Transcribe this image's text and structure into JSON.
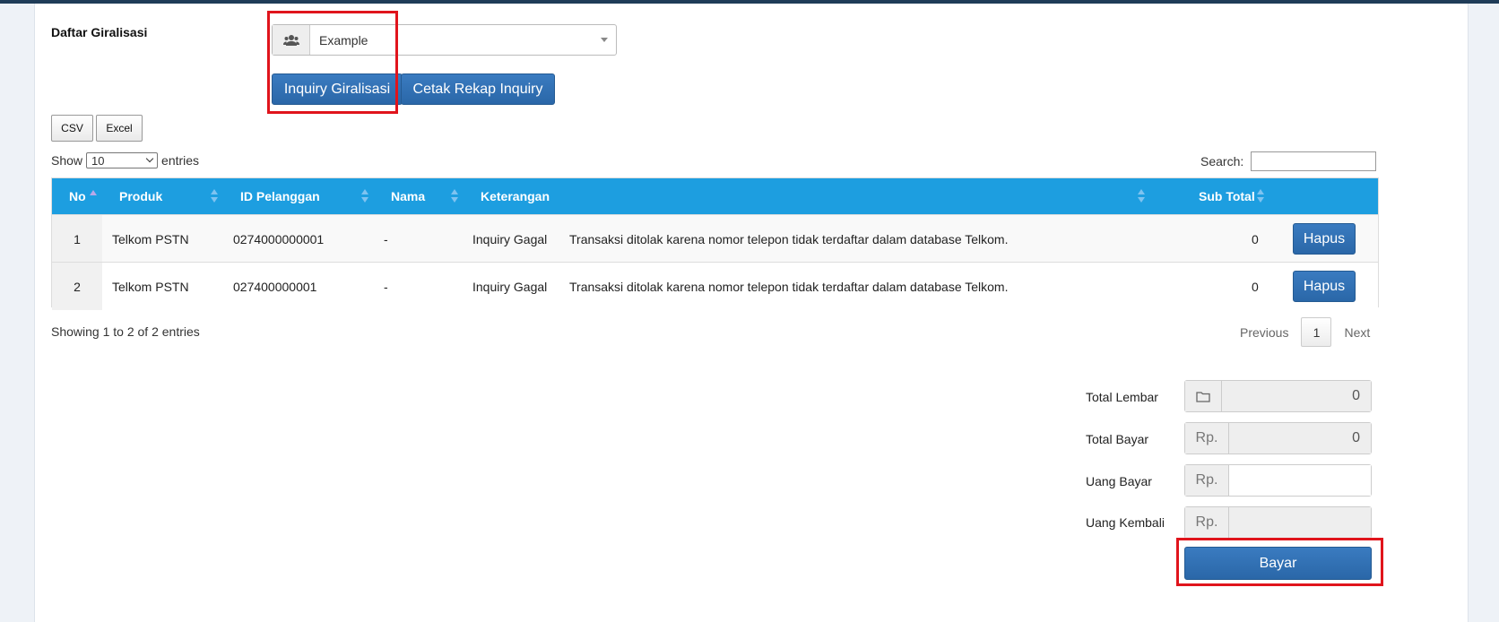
{
  "header": {
    "section_label": "Daftar Giralisasi"
  },
  "filter": {
    "selected_group": "Example",
    "group_icon": "users-icon"
  },
  "actions": {
    "inquiry_label": "Inquiry Giralisasi",
    "cetak_label": "Cetak Rekap Inquiry"
  },
  "export": {
    "csv_label": "CSV",
    "excel_label": "Excel"
  },
  "length": {
    "show_label": "Show",
    "entries_label": "entries",
    "selected": "10"
  },
  "search": {
    "label": "Search:",
    "value": ""
  },
  "table": {
    "columns": [
      "No",
      "Produk",
      "ID Pelanggan",
      "Nama",
      "Keterangan",
      "Sub Total"
    ],
    "rows": [
      {
        "no": "1",
        "produk": "Telkom PSTN",
        "id_pelanggan": "0274000000001",
        "nama": "-",
        "status": "Inquiry Gagal",
        "keterangan": "Transaksi ditolak karena nomor telepon tidak terdaftar dalam database Telkom.",
        "sub_total": "0",
        "action": "Hapus"
      },
      {
        "no": "2",
        "produk": "Telkom PSTN",
        "id_pelanggan": "027400000001",
        "nama": "-",
        "status": "Inquiry Gagal",
        "keterangan": "Transaksi ditolak karena nomor telepon tidak terdaftar dalam database Telkom.",
        "sub_total": "0",
        "action": "Hapus"
      }
    ]
  },
  "info": "Showing 1 to 2 of 2 entries",
  "pagination": {
    "previous": "Previous",
    "current": "1",
    "next": "Next"
  },
  "summary": {
    "total_lembar_label": "Total Lembar",
    "total_lembar_value": "0",
    "total_lembar_icon": "folder-icon",
    "total_bayar_label": "Total Bayar",
    "total_bayar_value": "0",
    "currency": "Rp.",
    "uang_bayar_label": "Uang Bayar",
    "uang_bayar_value": "",
    "uang_kembali_label": "Uang Kembali",
    "uang_kembali_value": ""
  },
  "pay_button": "Bayar",
  "colors": {
    "accent": "#1d9ee0",
    "button": "#2a67a8",
    "highlight": "#e0141c",
    "topbar": "#1f3c58"
  }
}
